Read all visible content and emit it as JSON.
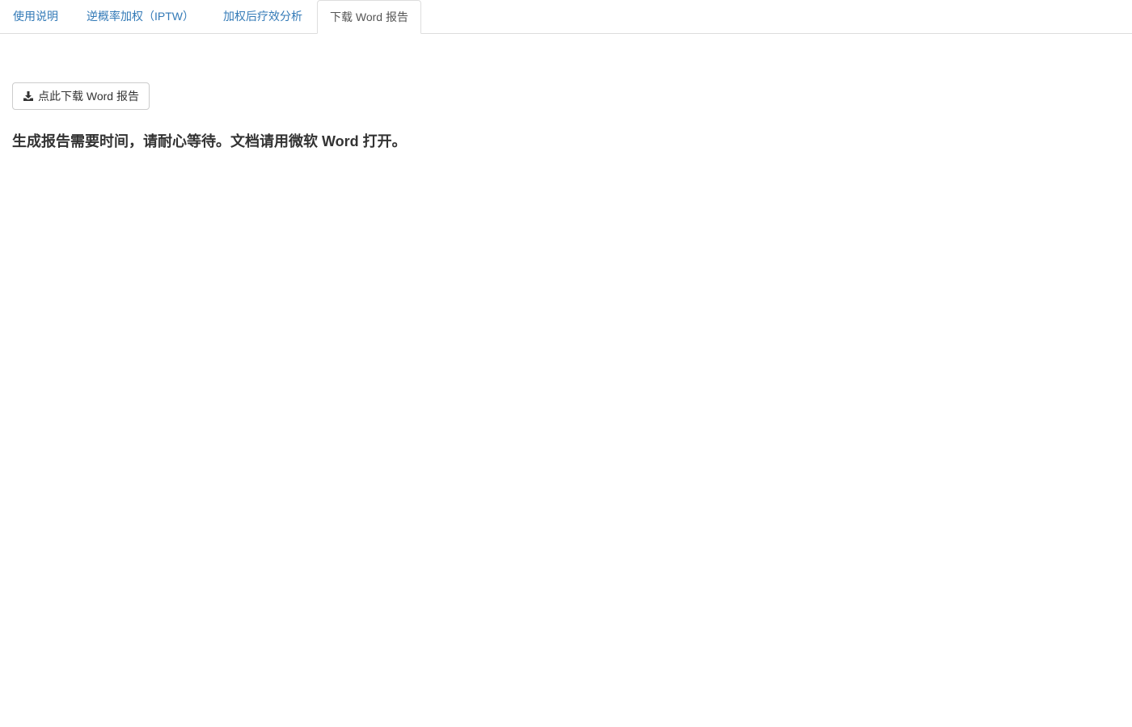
{
  "tabs": [
    {
      "label": "使用说明",
      "active": false
    },
    {
      "label": "逆概率加权（IPTW）",
      "active": false
    },
    {
      "label": "加权后疗效分析",
      "active": false
    },
    {
      "label": "下载 Word 报告",
      "active": true
    }
  ],
  "download_button": {
    "label": "点此下载 Word 报告",
    "icon": "download-icon"
  },
  "note": "生成报告需要时间，请耐心等待。文档请用微软 Word 打开。",
  "colors": {
    "link": "#337ab7",
    "text": "#333333",
    "border": "#dddddd"
  }
}
